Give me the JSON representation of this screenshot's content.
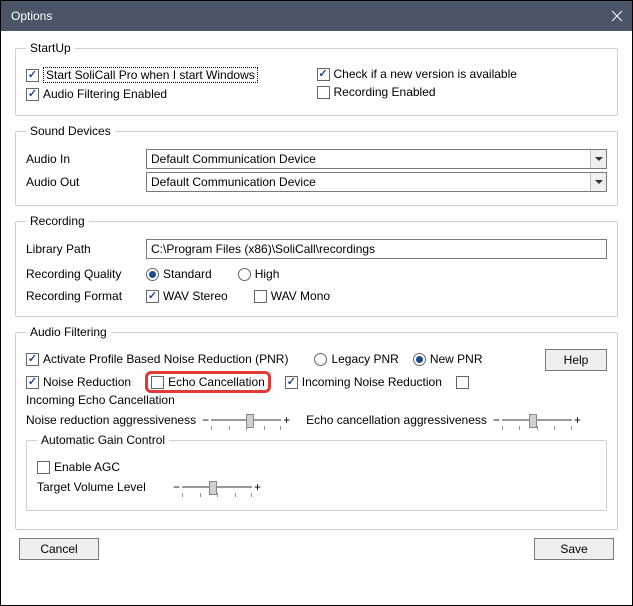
{
  "window": {
    "title": "Options"
  },
  "startup": {
    "legend": "StartUp",
    "start_with_windows": "Start SoliCall Pro when I start Windows",
    "audio_filtering_enabled": "Audio Filtering Enabled",
    "check_new_version": "Check if a new version is available",
    "recording_enabled": "Recording Enabled"
  },
  "sound_devices": {
    "legend": "Sound Devices",
    "audio_in_label": "Audio In",
    "audio_out_label": "Audio Out",
    "audio_in_value": "Default Communication Device",
    "audio_out_value": "Default Communication Device"
  },
  "recording": {
    "legend": "Recording",
    "library_path_label": "Library Path",
    "library_path_value": "C:\\Program Files (x86)\\SoliCall\\recordings",
    "quality_label": "Recording Quality",
    "standard": "Standard",
    "high": "High",
    "format_label": "Recording Format",
    "wav_stereo": "WAV Stereo",
    "wav_mono": "WAV Mono"
  },
  "audio_filtering": {
    "legend": "Audio Filtering",
    "help": "Help",
    "activate_pnr": "Activate Profile Based Noise Reduction (PNR)",
    "legacy_pnr": "Legacy PNR",
    "new_pnr": "New PNR",
    "noise_reduction": "Noise Reduction",
    "echo_cancellation": "Echo Cancellation",
    "incoming_noise_reduction": "Incoming Noise Reduction",
    "incoming_echo_cancellation": "Incoming Echo Cancellation",
    "nr_aggressiveness": "Noise reduction aggressiveness",
    "ec_aggressiveness": "Echo cancellation aggressiveness",
    "agc": {
      "legend": "Automatic Gain Control",
      "enable_agc": "Enable AGC",
      "target_volume": "Target Volume Level"
    }
  },
  "buttons": {
    "cancel": "Cancel",
    "save": "Save"
  }
}
